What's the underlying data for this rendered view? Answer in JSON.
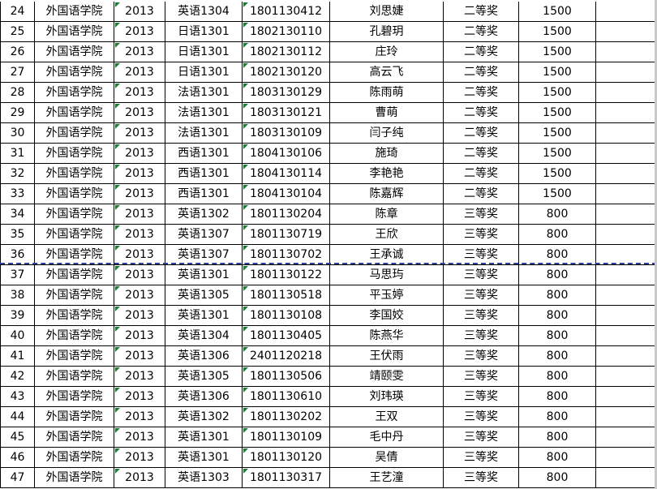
{
  "rows": [
    [
      "24",
      "外国语学院",
      "2013",
      "英语1304",
      "1801130412",
      "刘思婕",
      "二等奖",
      "1500"
    ],
    [
      "25",
      "外国语学院",
      "2013",
      "日语1301",
      "1802130110",
      "孔碧玥",
      "二等奖",
      "1500"
    ],
    [
      "26",
      "外国语学院",
      "2013",
      "日语1301",
      "1802130112",
      "庄玲",
      "二等奖",
      "1500"
    ],
    [
      "27",
      "外国语学院",
      "2013",
      "日语1301",
      "1802130120",
      "高云飞",
      "二等奖",
      "1500"
    ],
    [
      "28",
      "外国语学院",
      "2013",
      "法语1301",
      "1803130129",
      "陈雨萌",
      "二等奖",
      "1500"
    ],
    [
      "29",
      "外国语学院",
      "2013",
      "法语1301",
      "1803130121",
      "曹萌",
      "二等奖",
      "1500"
    ],
    [
      "30",
      "外国语学院",
      "2013",
      "法语1301",
      "1803130109",
      "闫子纯",
      "二等奖",
      "1500"
    ],
    [
      "31",
      "外国语学院",
      "2013",
      "西语1301",
      "1804130106",
      "施琦",
      "二等奖",
      "1500"
    ],
    [
      "32",
      "外国语学院",
      "2013",
      "西语1301",
      "1804130114",
      "李艳艳",
      "二等奖",
      "1500"
    ],
    [
      "33",
      "外国语学院",
      "2013",
      "西语1301",
      "1804130104",
      "陈嘉辉",
      "二等奖",
      "1500"
    ],
    [
      "34",
      "外国语学院",
      "2013",
      "英语1302",
      "1801130204",
      "陈章",
      "三等奖",
      "800"
    ],
    [
      "35",
      "外国语学院",
      "2013",
      "英语1307",
      "1801130719",
      "王欣",
      "三等奖",
      "800"
    ],
    [
      "36",
      "外国语学院",
      "2013",
      "英语1307",
      "1801130702",
      "王承诚",
      "三等奖",
      "800"
    ],
    [
      "37",
      "外国语学院",
      "2013",
      "英语1301",
      "1801130122",
      "马思玙",
      "三等奖",
      "800"
    ],
    [
      "38",
      "外国语学院",
      "2013",
      "英语1305",
      "1801130518",
      "平玉婷",
      "三等奖",
      "800"
    ],
    [
      "39",
      "外国语学院",
      "2013",
      "英语1301",
      "1801130108",
      "李国姣",
      "三等奖",
      "800"
    ],
    [
      "40",
      "外国语学院",
      "2013",
      "英语1304",
      "1801130405",
      "陈燕华",
      "三等奖",
      "800"
    ],
    [
      "41",
      "外国语学院",
      "2013",
      "英语1306",
      "2401120218",
      "王伏雨",
      "三等奖",
      "800"
    ],
    [
      "42",
      "外国语学院",
      "2013",
      "英语1305",
      "1801130506",
      "靖颐雯",
      "三等奖",
      "800"
    ],
    [
      "43",
      "外国语学院",
      "2013",
      "英语1306",
      "1801130610",
      "刘玮瑛",
      "三等奖",
      "800"
    ],
    [
      "44",
      "外国语学院",
      "2013",
      "英语1302",
      "1801130202",
      "王双",
      "三等奖",
      "800"
    ],
    [
      "45",
      "外国语学院",
      "2013",
      "英语1301",
      "1801130109",
      "毛中丹",
      "三等奖",
      "800"
    ],
    [
      "46",
      "外国语学院",
      "2013",
      "英语1301",
      "1801130120",
      "吴倩",
      "三等奖",
      "800"
    ],
    [
      "47",
      "外国语学院",
      "2013",
      "英语1303",
      "1801130317",
      "王艺潼",
      "三等奖",
      "800"
    ]
  ]
}
